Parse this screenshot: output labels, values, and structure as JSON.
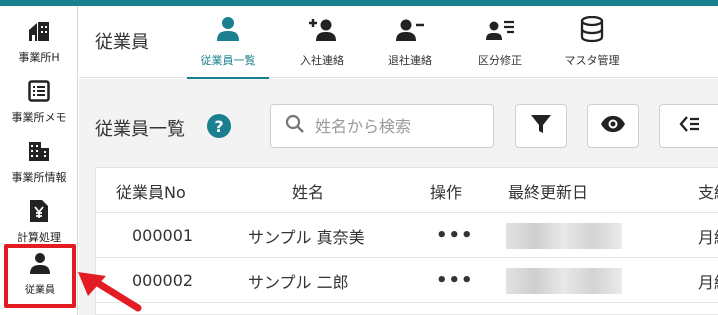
{
  "colors": {
    "accent": "#1a7f8e",
    "highlight": "#e31b23",
    "icon": "#222222"
  },
  "sidebar": {
    "items": [
      {
        "label": "事業所H",
        "icon": "building-home-icon"
      },
      {
        "label": "事業所メモ",
        "icon": "memo-list-icon"
      },
      {
        "label": "事業所情報",
        "icon": "office-building-icon"
      },
      {
        "label": "計算処理",
        "icon": "yen-document-icon"
      },
      {
        "label": "従業員",
        "icon": "person-icon",
        "active": true
      }
    ]
  },
  "header": {
    "title": "従業員",
    "tabs": [
      {
        "label": "従業員一覧",
        "icon": "person-icon",
        "active": true
      },
      {
        "label": "入社連絡",
        "icon": "person-add-icon"
      },
      {
        "label": "退社連絡",
        "icon": "person-remove-icon"
      },
      {
        "label": "区分修正",
        "icon": "person-list-icon"
      },
      {
        "label": "マスタ管理",
        "icon": "database-icon"
      }
    ]
  },
  "main": {
    "section_title": "従業員一覧",
    "help_label": "?",
    "search": {
      "placeholder": "姓名から検索",
      "value": ""
    },
    "table": {
      "columns": [
        "従業員No",
        "姓名",
        "操作",
        "最終更新日",
        "支給"
      ],
      "rows": [
        {
          "no": "000001",
          "name": "サンプル 真奈美",
          "action": "•••",
          "updated": "",
          "pay": "月給"
        },
        {
          "no": "000002",
          "name": "サンプル 二郎",
          "action": "•••",
          "updated": "",
          "pay": "月給"
        }
      ]
    }
  }
}
